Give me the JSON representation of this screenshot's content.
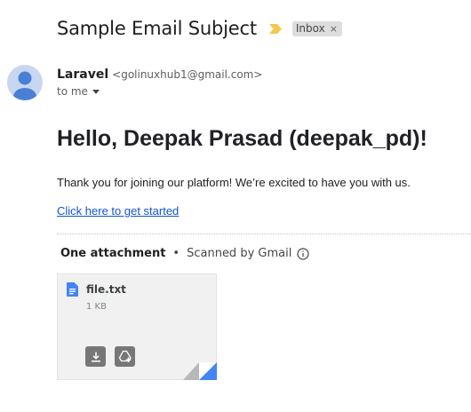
{
  "email": {
    "subject": "Sample Email Subject",
    "label_chip": "Inbox",
    "label_chip_close": "×",
    "sender_name": "Laravel",
    "sender_email": "<golinuxhub1@gmail.com>",
    "recipient": "to me"
  },
  "body": {
    "greeting": "Hello, Deepak Prasad (deepak_pd)!",
    "message": "Thank you for joining our platform! We’re excited to have you with us.",
    "link_text": "Click here to get started"
  },
  "attachments": {
    "count_label": "One attachment",
    "separator": "•",
    "scan_text": "Scanned by Gmail",
    "files": [
      {
        "name": "file.txt",
        "size": "1 KB"
      }
    ]
  },
  "icons": {
    "importance": "importance-marker-icon",
    "info": "info-icon",
    "avatar": "person-icon",
    "file": "document-icon",
    "download": "download-icon",
    "drive": "add-to-drive-icon"
  },
  "colors": {
    "importance": "#f2c94c",
    "link": "#1155cc",
    "avatar_bg": "#c7d7f2",
    "avatar_fg": "#4a7fd6",
    "file_icon": "#4285f4",
    "chip_bg": "#dddddd"
  }
}
